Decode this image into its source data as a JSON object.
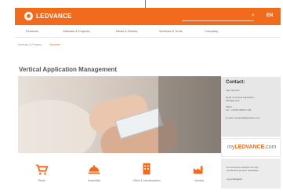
{
  "header": {
    "logo": "LEDVANCE",
    "lang": "EN"
  },
  "nav": [
    "Products",
    "Verticals & Projects",
    "News & Stories",
    "Services & Tools",
    "Company"
  ],
  "breadcrumb": [
    "Verticals & Projects",
    "Services"
  ],
  "page": {
    "title": "Vertical Application Management"
  },
  "contact": {
    "heading": "Contact:",
    "name": "Ingo Strosetz",
    "role1": "Head of Vertical Application",
    "role2": "Management",
    "office_label": "Office",
    "phone": "Tel.: +49 89 780673 136",
    "email": "E-mail: i.strosetz@ledvance.com"
  },
  "promo": {
    "logo_prefix": "my",
    "logo_brand": "LEDVANCE",
    "logo_suffix": ".com"
  },
  "side": {
    "line1": "E-Commerce solutions for fast",
    "line2": "and flexible product availability",
    "link": "Log in/Register"
  },
  "tiles": [
    {
      "label": "Retail",
      "icon": "cart-icon"
    },
    {
      "label": "Hospitality",
      "icon": "cloche-icon"
    },
    {
      "label": "Office & Administration",
      "icon": "building-icon"
    },
    {
      "label": "Industry",
      "icon": "factory-icon"
    }
  ],
  "colors": {
    "brand": "#f26a1b",
    "panel": "#e7e7e7"
  }
}
